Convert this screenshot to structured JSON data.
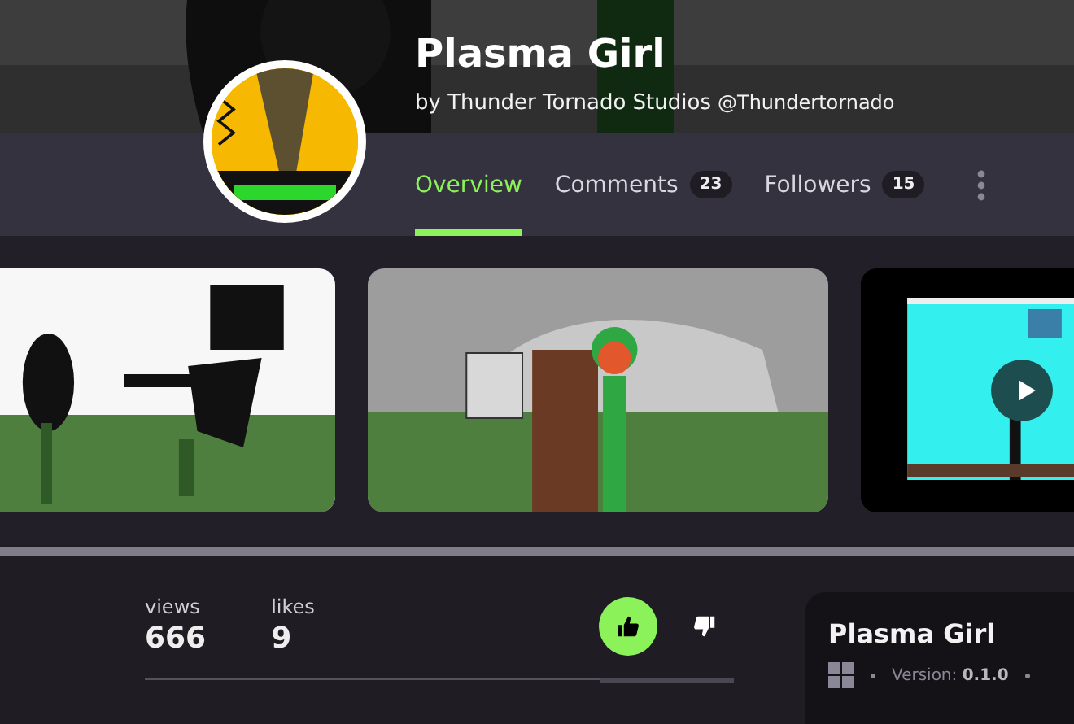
{
  "title": "Plasma Girl",
  "byline": {
    "author": "by Thunder Tornado Studios",
    "handle": "@Thundertornado"
  },
  "tabs": [
    {
      "label": "Overview",
      "selected": true
    },
    {
      "label": "Comments",
      "count": "23",
      "selected": false
    },
    {
      "label": "Followers",
      "count": "15",
      "selected": false
    }
  ],
  "media": [
    {
      "kind": "picture"
    },
    {
      "kind": "picture"
    },
    {
      "kind": "video"
    }
  ],
  "stats": [
    {
      "label": "views",
      "value": "666"
    },
    {
      "label": "likes",
      "value": "9"
    }
  ],
  "vote": {
    "liked": true,
    "disliked": false
  },
  "info": {
    "title": "Plasma Girl",
    "version": "Version: **0.1.0**"
  }
}
